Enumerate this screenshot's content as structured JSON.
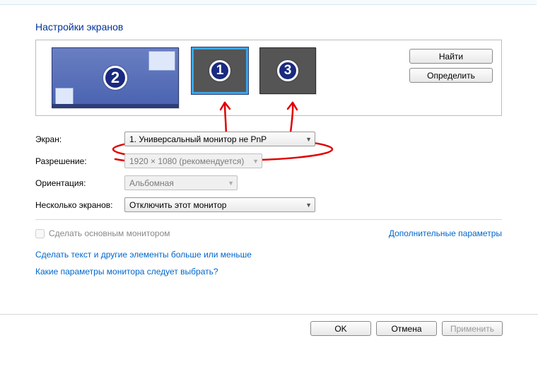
{
  "title": "Настройки экранов",
  "monitors": {
    "m1": "1",
    "m2": "2",
    "m3": "3"
  },
  "buttons": {
    "find": "Найти",
    "identify": "Определить",
    "ok": "OK",
    "cancel": "Отмена",
    "apply": "Применить"
  },
  "labels": {
    "display": "Экран:",
    "resolution": "Разрешение:",
    "orientation": "Ориентация:",
    "multiple": "Несколько экранов:",
    "make_primary": "Сделать основным монитором",
    "advanced": "Дополнительные параметры"
  },
  "selects": {
    "display": "1. Универсальный монитор не PnP",
    "resolution": "1920 × 1080 (рекомендуется)",
    "orientation": "Альбомная",
    "multiple": "Отключить этот монитор"
  },
  "links": {
    "text_size": "Сделать текст и другие элементы больше или меньше",
    "which_params": "Какие параметры монитора следует выбрать?"
  }
}
